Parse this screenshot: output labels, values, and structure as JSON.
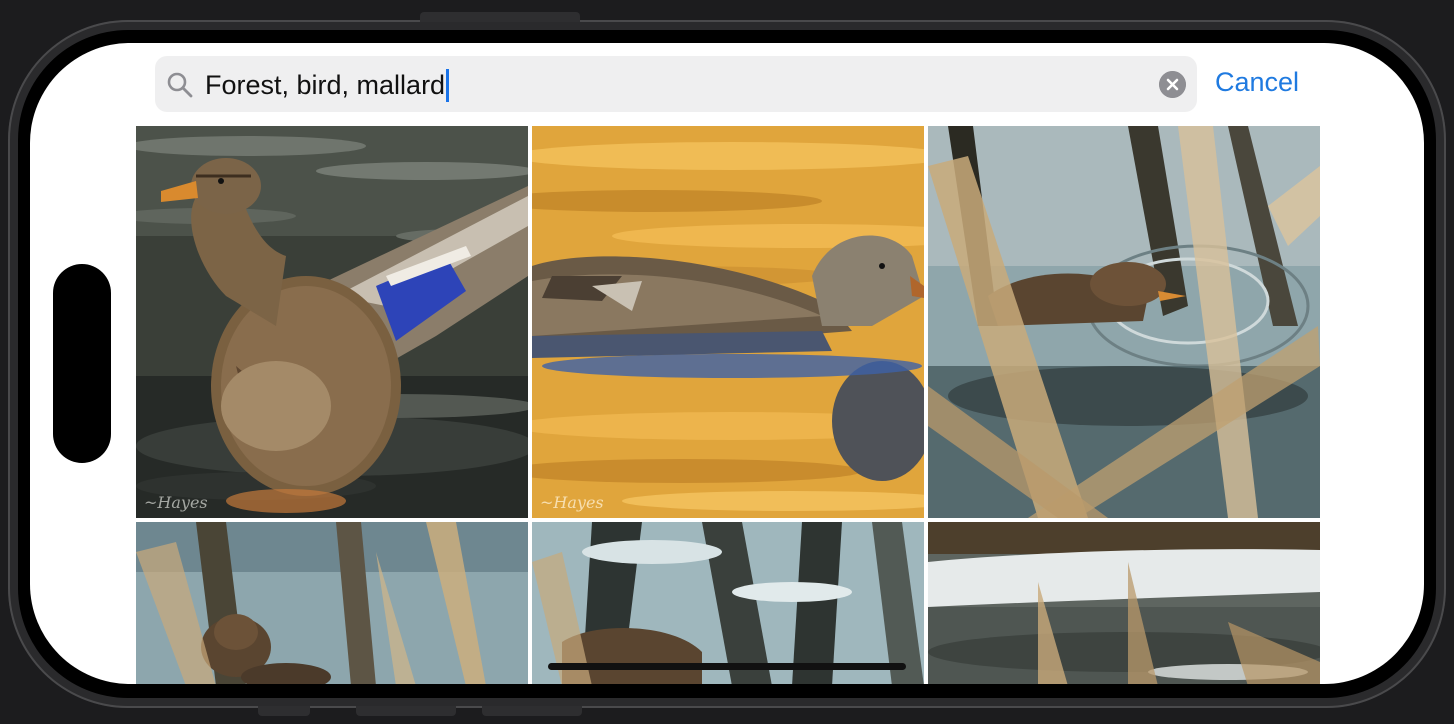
{
  "search": {
    "query": "Forest, bird, mallard",
    "icon": "magnifier-icon",
    "clear_icon": "clear-x-icon"
  },
  "cancel_label": "Cancel",
  "colors": {
    "accent": "#1f7ae0",
    "search_bg": "#efeff0"
  },
  "photos": [
    {
      "subject": "mallard hen spreading wings in water"
    },
    {
      "subject": "mallard swimming on golden water"
    },
    {
      "subject": "mallard swimming behind reeds"
    },
    {
      "subject": "mallard in reflective water with reeds"
    },
    {
      "subject": "mallard among reflections"
    },
    {
      "subject": "frozen pond with reeds"
    }
  ]
}
